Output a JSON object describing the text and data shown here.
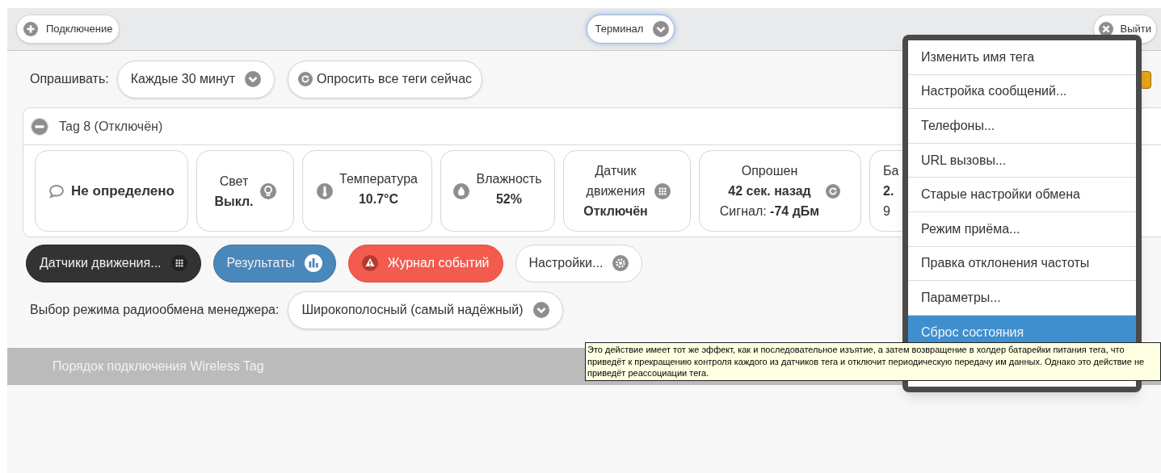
{
  "header": {
    "connect_button": "Подключение",
    "mode_select": "Терминал",
    "logout_button": "Выйти"
  },
  "poll": {
    "label": "Опрашивать:",
    "interval": "Каждые 30 минут",
    "poll_all_button": "Опросить все теги сейчас"
  },
  "tag": {
    "title": "Tag 8 (Отключён)",
    "expanded": true,
    "cards": [
      {
        "kind": "status",
        "value": "Не определено"
      },
      {
        "kind": "sensor",
        "label_lines": [
          "Свет"
        ],
        "value": "Выкл."
      },
      {
        "kind": "sensor",
        "label_lines": [
          "Температура"
        ],
        "value": "10.7°C"
      },
      {
        "kind": "sensor",
        "label_lines": [
          "Влажность"
        ],
        "value": "52%"
      },
      {
        "kind": "sensor",
        "label_lines": [
          "Датчик",
          "движения"
        ],
        "value": "Отключён"
      },
      {
        "kind": "sensor",
        "label_lines": [
          "Опрошен"
        ],
        "value": "42 сек. назад",
        "note": "Сигнал: **-74 дБм**"
      },
      {
        "kind": "partial",
        "label_lines": [
          "Ба"
        ],
        "value": "2.",
        "note": "9"
      }
    ]
  },
  "actions": [
    {
      "label": "Датчики движения...",
      "kind": "dark"
    },
    {
      "label": "Результаты",
      "kind": "blue"
    },
    {
      "label": "Журнал событий",
      "kind": "red"
    },
    {
      "label": "Настройки...",
      "kind": "light"
    }
  ],
  "radio_mode": {
    "label": "Выбор режима радиообмена менеджера:",
    "value": "Широкополосный (самый надёжный)"
  },
  "section_bar": {
    "title": "Порядок подключения Wireless Tag"
  },
  "menu": {
    "items": [
      {
        "label": "Изменить имя тега",
        "selected": false
      },
      {
        "label": "Настройка сообщений...",
        "selected": false
      },
      {
        "label": "Телефоны...",
        "selected": false
      },
      {
        "label": "URL вызовы...",
        "selected": false
      },
      {
        "label": "Старые настройки обмена",
        "selected": false
      },
      {
        "label": "Режим приёма...",
        "selected": false
      },
      {
        "label": "Правка отклонения частоты",
        "selected": false
      },
      {
        "label": "Параметры...",
        "selected": false
      },
      {
        "label": "Сброс состояния",
        "selected": true
      }
    ]
  },
  "tooltip": {
    "text": "Это действие имеет тот же эффект, как и последовательное изъятие, а затем возвращение в холдер батарейки питания тега, что приведёт к прекращению контроля каждого из датчиков тега и отключит периодическую передачу им данных. Однако это действие не приведёт реассоциации тега."
  }
}
